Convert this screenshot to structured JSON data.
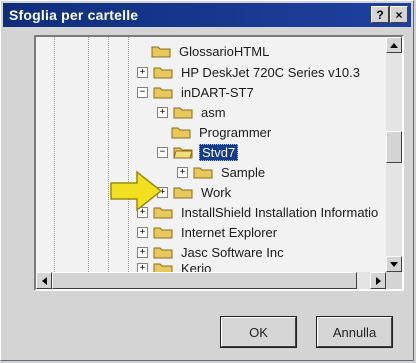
{
  "window": {
    "title": "Sfoglia per cartelle",
    "help_glyph": "?",
    "close_glyph": "×"
  },
  "tree": {
    "items": [
      {
        "label": "GlossarioHTML",
        "expander": ""
      },
      {
        "label": "HP DeskJet 720C Series v10.3",
        "expander": "+"
      },
      {
        "label": "inDART-ST7",
        "expander": "−"
      },
      {
        "label": "asm",
        "expander": "+"
      },
      {
        "label": "Programmer",
        "expander": ""
      },
      {
        "label": "Stvd7",
        "expander": "−",
        "selected": true
      },
      {
        "label": "Sample",
        "expander": "+"
      },
      {
        "label": "Work",
        "expander": "+"
      },
      {
        "label": "InstallShield Installation Informatio",
        "expander": "+"
      },
      {
        "label": "Internet Explorer",
        "expander": "+"
      },
      {
        "label": "Jasc Software Inc",
        "expander": "+"
      },
      {
        "label": "Kerio",
        "expander": "+"
      }
    ]
  },
  "buttons": {
    "ok": "OK",
    "cancel": "Annulla"
  },
  "colors": {
    "titlebar": "#0e2e7c",
    "folder": "#e8c85a",
    "selection": "#143c8a",
    "arrow": "#f0e020"
  },
  "icons": {
    "folder": "folder-icon",
    "arrow": "yellow-pointer-arrow-icon"
  }
}
